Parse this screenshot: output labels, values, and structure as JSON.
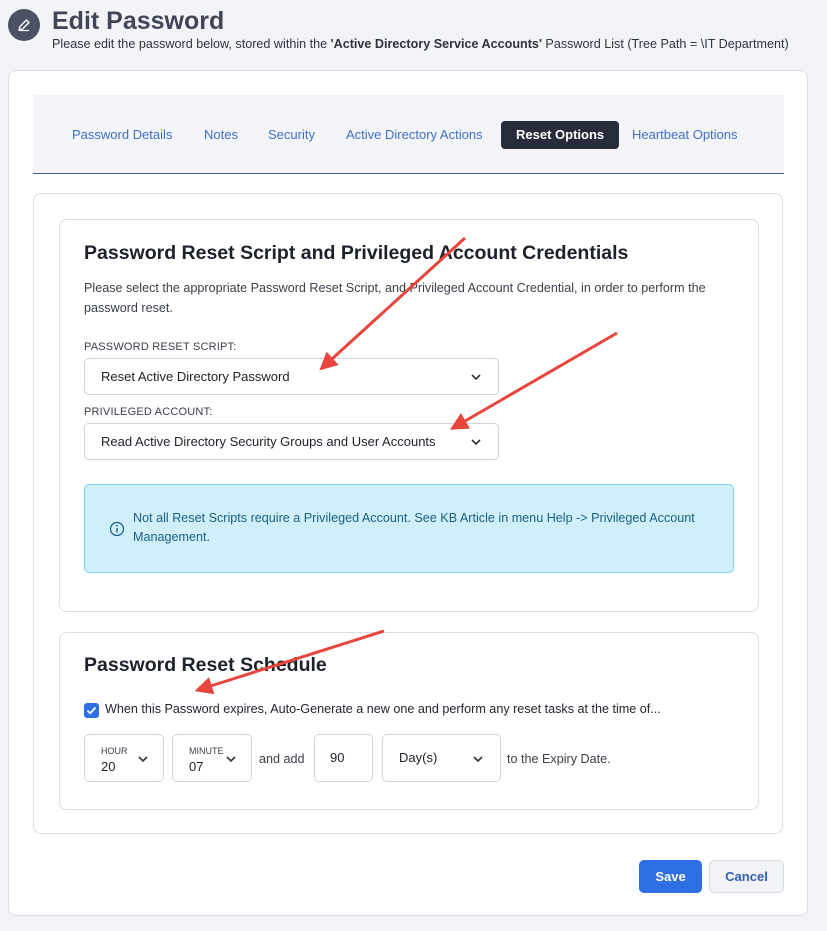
{
  "header": {
    "title": "Edit Password",
    "subtitle_prefix": "Please edit the password below, stored within the ",
    "subtitle_list_name": "'Active Directory Service Accounts'",
    "subtitle_suffix": " Password List (Tree Path = \\IT Department)",
    "icon": "pencil-icon"
  },
  "tabs": [
    {
      "label": "Password Details",
      "active": false
    },
    {
      "label": "Notes",
      "active": false
    },
    {
      "label": "Security",
      "active": false
    },
    {
      "label": "Active Directory Actions",
      "active": false
    },
    {
      "label": "Reset Options",
      "active": true
    },
    {
      "label": "Heartbeat Options",
      "active": false
    }
  ],
  "credentials_section": {
    "title": "Password Reset Script and Privileged Account Credentials",
    "description": "Please select the appropriate Password Reset Script, and Privileged Account Credential, in order to perform the password reset.",
    "script_label": "Password Reset Script:",
    "script_value": "Reset Active Directory Password",
    "account_label": "Privileged Account:",
    "account_value": "Read Active Directory Security Groups and User Accounts",
    "info_text": "Not all Reset Scripts require a Privileged Account. See KB Article in menu Help -> Privileged Account Management.",
    "info_icon": "info-circle-icon"
  },
  "schedule_section": {
    "title": "Password Reset Schedule",
    "checkbox_checked": true,
    "checkbox_label": "When this Password expires, Auto-Generate a new one and perform any reset tasks at the time of...",
    "hour_label": "Hour",
    "hour_value": "20",
    "minute_label": "Minute",
    "minute_value": "07",
    "and_add_text": "and add",
    "days_value": "90",
    "unit_value": "Day(s)",
    "suffix_text": "to the Expiry Date."
  },
  "buttons": {
    "save": "Save",
    "cancel": "Cancel"
  },
  "colors": {
    "accent": "#2f6fe4",
    "active_tab": "#262c3a",
    "annotation_arrow": "#e8453c",
    "info_bg": "#cfeffb"
  }
}
